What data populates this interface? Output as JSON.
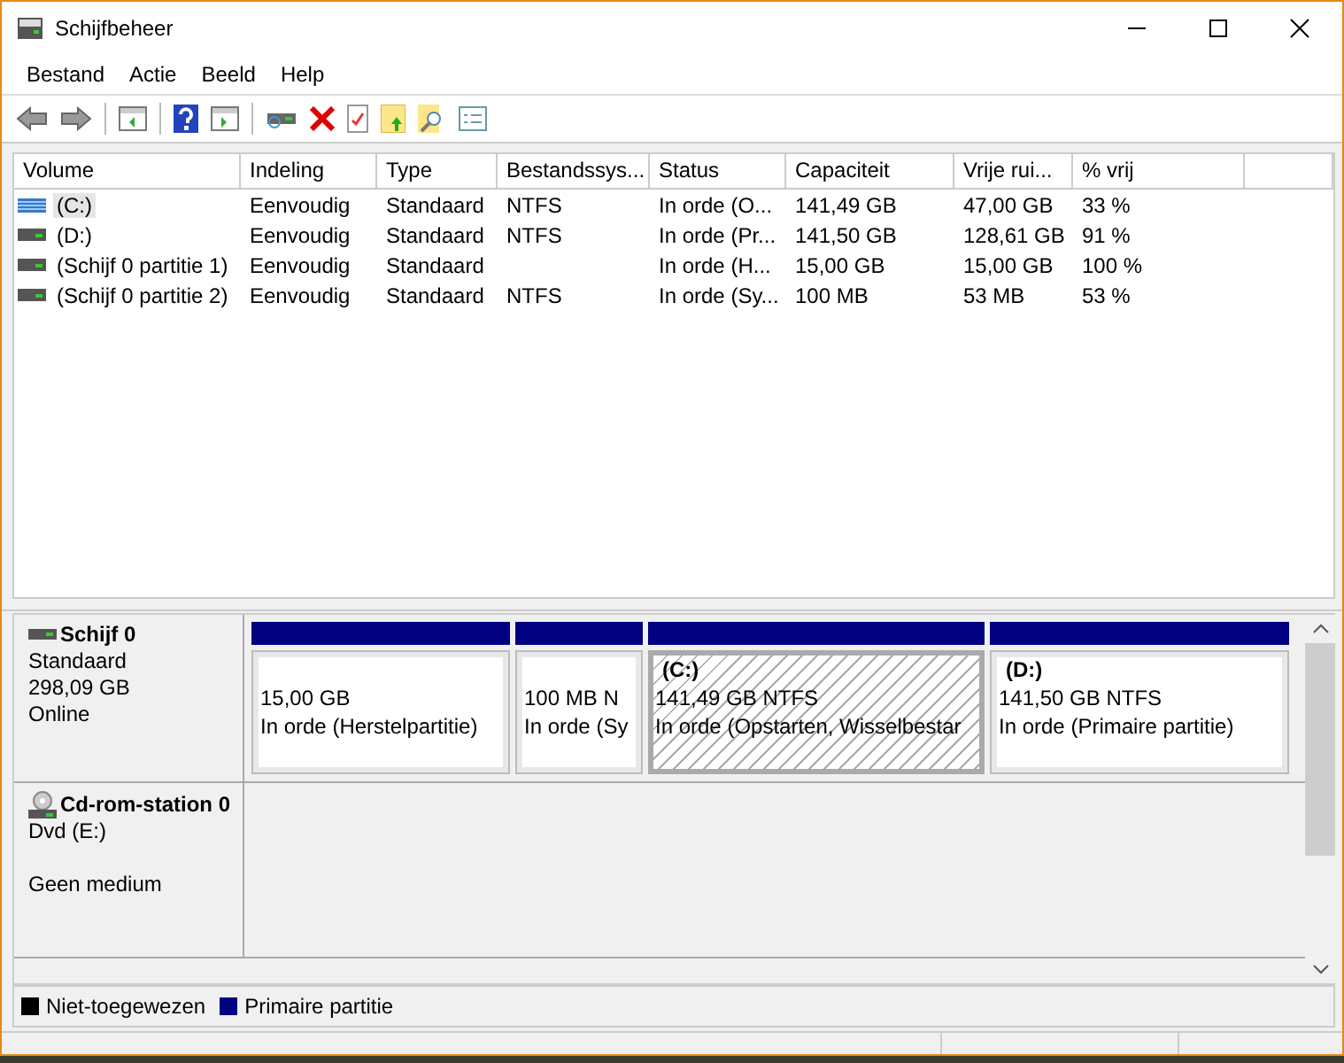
{
  "window": {
    "title": "Schijfbeheer"
  },
  "menu": [
    "Bestand",
    "Actie",
    "Beeld",
    "Help"
  ],
  "table": {
    "columns": [
      "Volume",
      "Indeling",
      "Type",
      "Bestandssys...",
      "Status",
      "Capaciteit",
      "Vrije rui...",
      "% vrij"
    ],
    "rows": [
      {
        "selected": true,
        "kind": "striped",
        "cells": [
          "(C:)",
          "Eenvoudig",
          "Standaard",
          "NTFS",
          "In orde (O...",
          "141,49 GB",
          "47,00 GB",
          "33 %"
        ]
      },
      {
        "selected": false,
        "kind": "plain",
        "cells": [
          "(D:)",
          "Eenvoudig",
          "Standaard",
          "NTFS",
          "In orde (Pr...",
          "141,50 GB",
          "128,61 GB",
          "91 %"
        ]
      },
      {
        "selected": false,
        "kind": "plain",
        "cells": [
          "(Schijf 0 partitie 1)",
          "Eenvoudig",
          "Standaard",
          "",
          "In orde (H...",
          "15,00 GB",
          "15,00 GB",
          "100 %"
        ]
      },
      {
        "selected": false,
        "kind": "plain",
        "cells": [
          "(Schijf 0 partitie 2)",
          "Eenvoudig",
          "Standaard",
          "NTFS",
          "In orde (Sy...",
          "100 MB",
          "53 MB",
          "53 %"
        ]
      }
    ]
  },
  "disks": [
    {
      "kind": "disk",
      "name": "Schijf 0",
      "lines": [
        "Standaard",
        "298,09 GB",
        "Online"
      ],
      "partitions": [
        {
          "selected": false,
          "size": "15,00 GB",
          "status": "In orde (Herstelpartitie)"
        },
        {
          "selected": false,
          "size": "100 MB N",
          "status": "In orde (Sy"
        },
        {
          "selected": true,
          "label": "(C:)",
          "size": "141,49 GB NTFS",
          "status": "In orde (Opstarten, Wisselbestar"
        },
        {
          "selected": false,
          "label": "(D:)",
          "size": "141,50 GB NTFS",
          "status": "In orde (Primaire partitie)"
        }
      ]
    },
    {
      "kind": "cdrom",
      "name": "Cd-rom-station 0",
      "lines": [
        "Dvd (E:)",
        "Geen medium"
      ]
    }
  ],
  "legend": [
    {
      "label": "Niet-toegewezen",
      "color": "#000000"
    },
    {
      "label": "Primaire partitie",
      "color": "#000080"
    }
  ]
}
